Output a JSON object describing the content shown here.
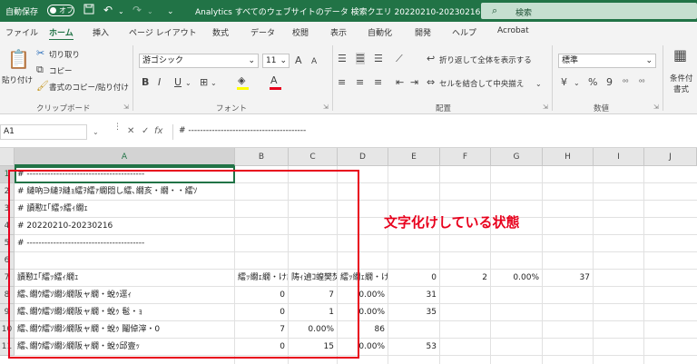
{
  "titlebar": {
    "autosave_label": "自動保存",
    "autosave_state": "オフ",
    "save_icon": "save-icon",
    "undo_icon": "undo-icon",
    "redo_icon": "redo-icon",
    "document_title": "Analytics すべてのウェブサイトのデータ 検索クエリ 20220210-20230216 ⌄",
    "search_label": "検索",
    "bg_color": "#217346"
  },
  "tabs": [
    "ファイル",
    "ホーム",
    "挿入",
    "ページ レイアウト",
    "数式",
    "データ",
    "校閲",
    "表示",
    "自動化",
    "開発",
    "ヘルプ",
    "Acrobat"
  ],
  "ribbon": {
    "clipboard": {
      "paste": "貼り付け",
      "cut": "切り取り",
      "copy": "コピー",
      "format_painter": "書式のコピー/貼り付け",
      "label": "クリップボード"
    },
    "font": {
      "name": "游ゴシック",
      "size": "11",
      "bold": "B",
      "italic": "I",
      "underline": "U",
      "grow": "A",
      "shrink": "A",
      "label": "フォント",
      "highlight_color": "#ffff00",
      "font_color": "#e8001c"
    },
    "alignment": {
      "wrap_text": "折り返して全体を表示する",
      "merge_center": "セルを結合して中央揃え",
      "label": "配置"
    },
    "number": {
      "format": "標準",
      "currency": "¥",
      "percent": "%",
      "comma": "9",
      "label": "数値"
    },
    "styles": {
      "conditional_1": "条件付",
      "conditional_2": "書式"
    }
  },
  "formula_bar": {
    "name_box": "A1",
    "cancel": "✕",
    "enter": "✓",
    "fx": "fx",
    "content": "# ----------------------------------------"
  },
  "grid": {
    "columns": [
      "A",
      "B",
      "C",
      "D",
      "E",
      "F",
      "G",
      "H",
      "I",
      "J"
    ],
    "rows": [
      "1",
      "2",
      "3",
      "4",
      "5",
      "6",
      "7",
      "8",
      "9",
      "10",
      "11"
    ],
    "cells": {
      "A1": "# ----------------------------------------",
      "A2": "# 縺吶∋縺ｦ縺ｮ繧ｦ繧ｧ繝悶し繧､繝亥・繝・・繧ｿ",
      "A3": "# 讀懃ｴ｢繧ｯ繧ｨ繝ｪ",
      "A4": "# 20220210-20230216",
      "A5": "# ----------------------------------------",
      "A7": "讀懃ｴ｢繧ｯ繧ｨ繝ｪ",
      "B7": "繧ｯ繝ｪ繝・け謨ｰ",
      "C7": "陦ｨ遉ｺ蝗樊焚",
      "D7": "繧ｯ繝ｪ繝・け邇",
      "E7": "0",
      "F7": "2",
      "G7": "0.00%",
      "H7": "37",
      "A8": "繧､繝ｳ繧ｿ繝ｼ繝阪ャ繝・蛻ｩ逕ｨ",
      "B8": "0",
      "C8": "7",
      "D8": "0.00%",
      "E8": "31",
      "A9": "繧､繝ｳ繧ｿ繝ｼ繝阪ャ繝・蛻ｩ 髢・ｮ",
      "B9": "0",
      "C9": "1",
      "D9": "0.00%",
      "E9": "35",
      "A10": "繧､繝ｳ繧ｿ繝ｼ繝阪ャ繝・蛻ｩ 鬮倬滓・0",
      "B10": "7",
      "C10": "0.00%",
      "D10": "86",
      "A11": "繧､繝ｳ繧ｿ繝ｼ繝阪ャ繝・蛻ｩ邱壹ｯ",
      "B11": "0",
      "C11": "15",
      "D11": "0.00%",
      "E11": "53"
    }
  },
  "annotation": {
    "text": "文字化けしている状態",
    "color": "#e8001c"
  }
}
